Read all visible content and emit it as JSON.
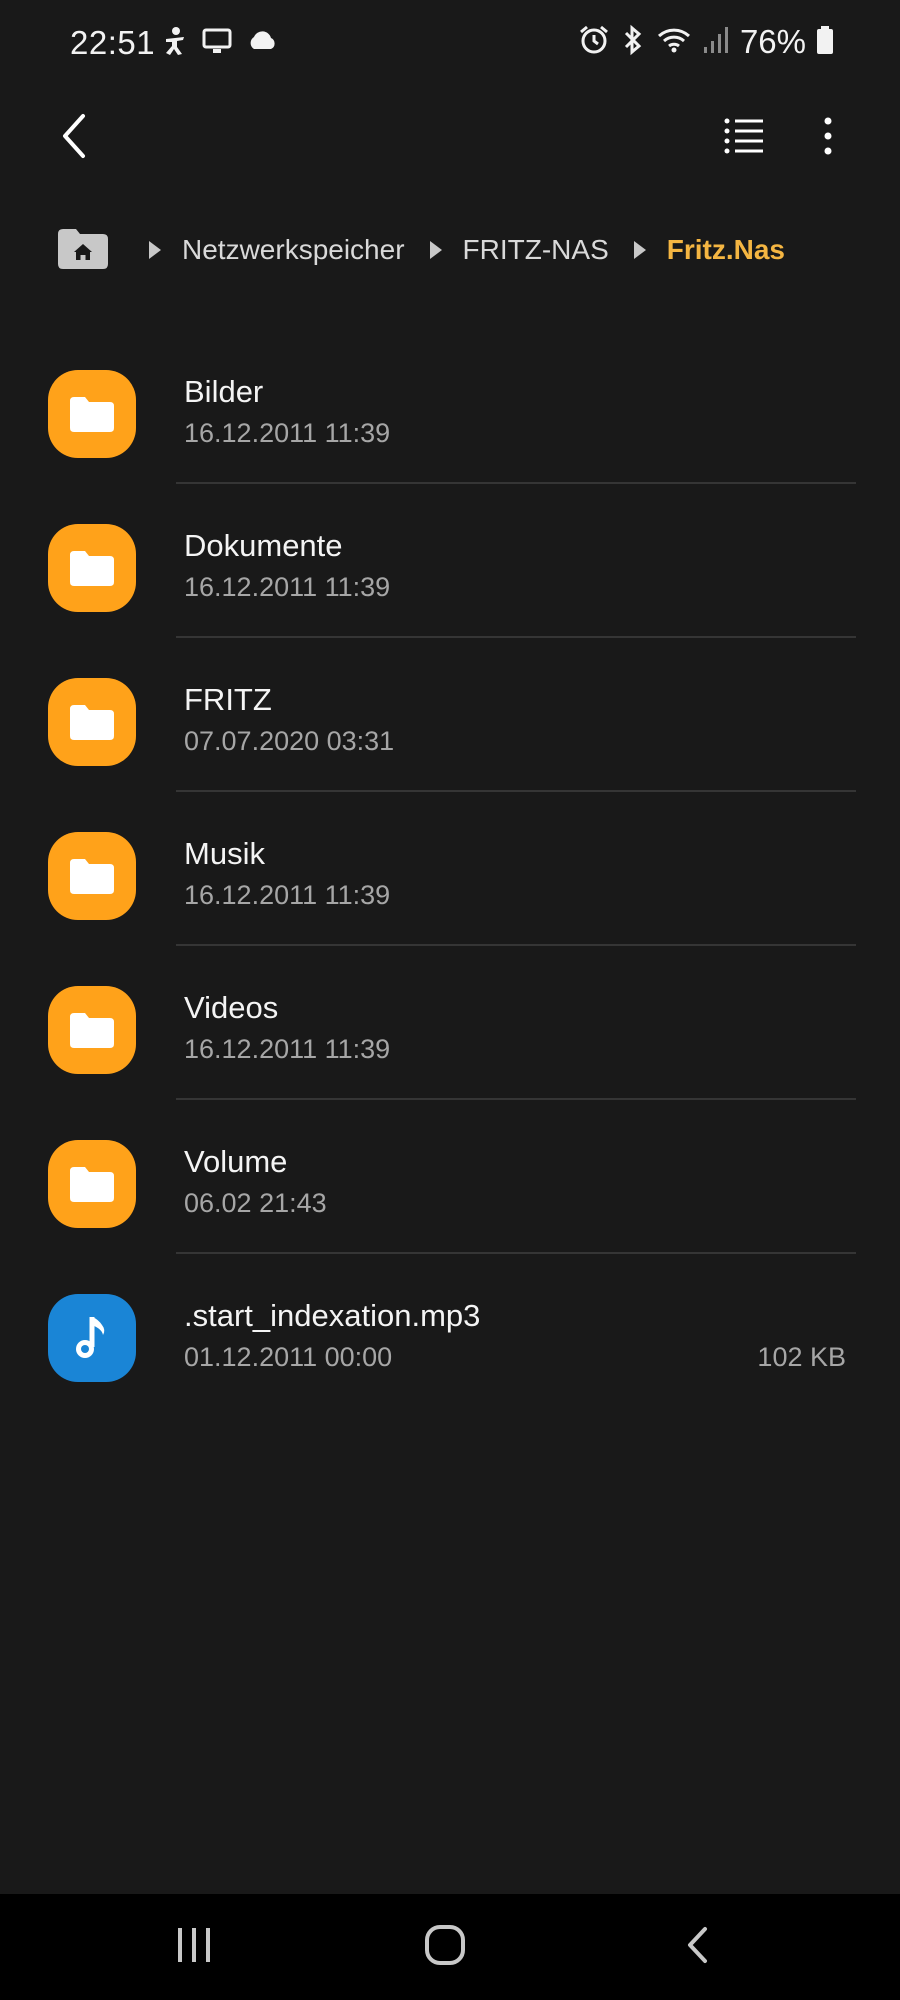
{
  "status_bar": {
    "time": "22:51",
    "left_icons": [
      "accessibility-icon",
      "screen-cast-icon",
      "cloud-icon"
    ],
    "right_icons": [
      "alarm-icon",
      "bluetooth-icon",
      "wifi-icon",
      "signal-icon"
    ],
    "battery_percent": "76%"
  },
  "app_bar": {
    "back_icon": "back-arrow-icon",
    "list_view_icon": "list-view-icon",
    "more_icon": "more-vert-icon"
  },
  "breadcrumb": {
    "home_icon": "home-icon",
    "items": [
      {
        "label": "Netzwerkspeicher"
      },
      {
        "label": "FRITZ-NAS"
      },
      {
        "label": "Fritz.Nas"
      }
    ]
  },
  "files": [
    {
      "name": "Bilder",
      "date": "16.12.2011 11:39",
      "size": "",
      "type": "folder"
    },
    {
      "name": "Dokumente",
      "date": "16.12.2011 11:39",
      "size": "",
      "type": "folder"
    },
    {
      "name": "FRITZ",
      "date": "07.07.2020 03:31",
      "size": "",
      "type": "folder"
    },
    {
      "name": "Musik",
      "date": "16.12.2011 11:39",
      "size": "",
      "type": "folder"
    },
    {
      "name": "Videos",
      "date": "16.12.2011 11:39",
      "size": "",
      "type": "folder"
    },
    {
      "name": "Volume",
      "date": "06.02 21:43",
      "size": "",
      "type": "folder"
    },
    {
      "name": ".start_indexation.mp3",
      "date": "01.12.2011 00:00",
      "size": "102 KB",
      "type": "audio"
    }
  ],
  "nav_bar": {
    "recents_icon": "recents-icon",
    "home_icon": "home-button-icon",
    "back_icon": "back-icon"
  },
  "colors": {
    "background": "#191919",
    "accent": "#f5b642",
    "folder": "#ffa21a",
    "audio": "#1a85d6"
  }
}
